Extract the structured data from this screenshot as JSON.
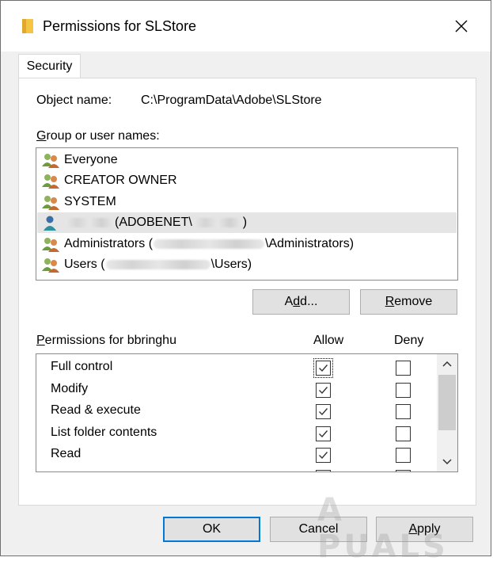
{
  "window": {
    "title": "Permissions for SLStore",
    "close_glyph": "✕"
  },
  "tabs": [
    {
      "label": "Security"
    }
  ],
  "object": {
    "label": "Object name:",
    "value": "C:\\ProgramData\\Adobe\\SLStore"
  },
  "group": {
    "label_prefix": "",
    "label_accel": "G",
    "label_rest": "roup or user names:",
    "users": [
      {
        "parts": [
          "Everyone"
        ],
        "icon": "group-users-icon",
        "selected": false
      },
      {
        "parts": [
          "CREATOR OWNER"
        ],
        "icon": "group-users-icon",
        "selected": false
      },
      {
        "parts": [
          "SYSTEM"
        ],
        "icon": "group-users-icon",
        "selected": false
      },
      {
        "parts": [
          "",
          "(ADOBENET\\",
          ")"
        ],
        "icon": "single-user-icon",
        "selected": true
      },
      {
        "parts": [
          "Administrators (",
          "\\Administrators)"
        ],
        "icon": "group-users-icon",
        "selected": false
      },
      {
        "parts": [
          "Users (",
          "\\Users)"
        ],
        "icon": "group-users-icon",
        "selected": false
      }
    ]
  },
  "buttons": {
    "add_pre": "A",
    "add_accel": "d",
    "add_post": "d...",
    "remove_accel": "R",
    "remove_post": "emove",
    "ok": "OK",
    "cancel": "Cancel",
    "apply_accel": "A",
    "apply_post": "pply"
  },
  "permissions": {
    "label_accel": "P",
    "label_rest": "ermissions for bbringhu",
    "allow_header": "Allow",
    "deny_header": "Deny",
    "rows": [
      {
        "name": "Full control",
        "allow": true,
        "deny": false
      },
      {
        "name": "Modify",
        "allow": true,
        "deny": false
      },
      {
        "name": "Read & execute",
        "allow": true,
        "deny": false
      },
      {
        "name": "List folder contents",
        "allow": true,
        "deny": false
      },
      {
        "name": "Read",
        "allow": true,
        "deny": false
      }
    ]
  },
  "watermark": "A PUALS",
  "colors": {
    "focus_blue": "#0078d7",
    "selected_row": "#e5e5e5",
    "button_face": "#e1e1e1"
  }
}
